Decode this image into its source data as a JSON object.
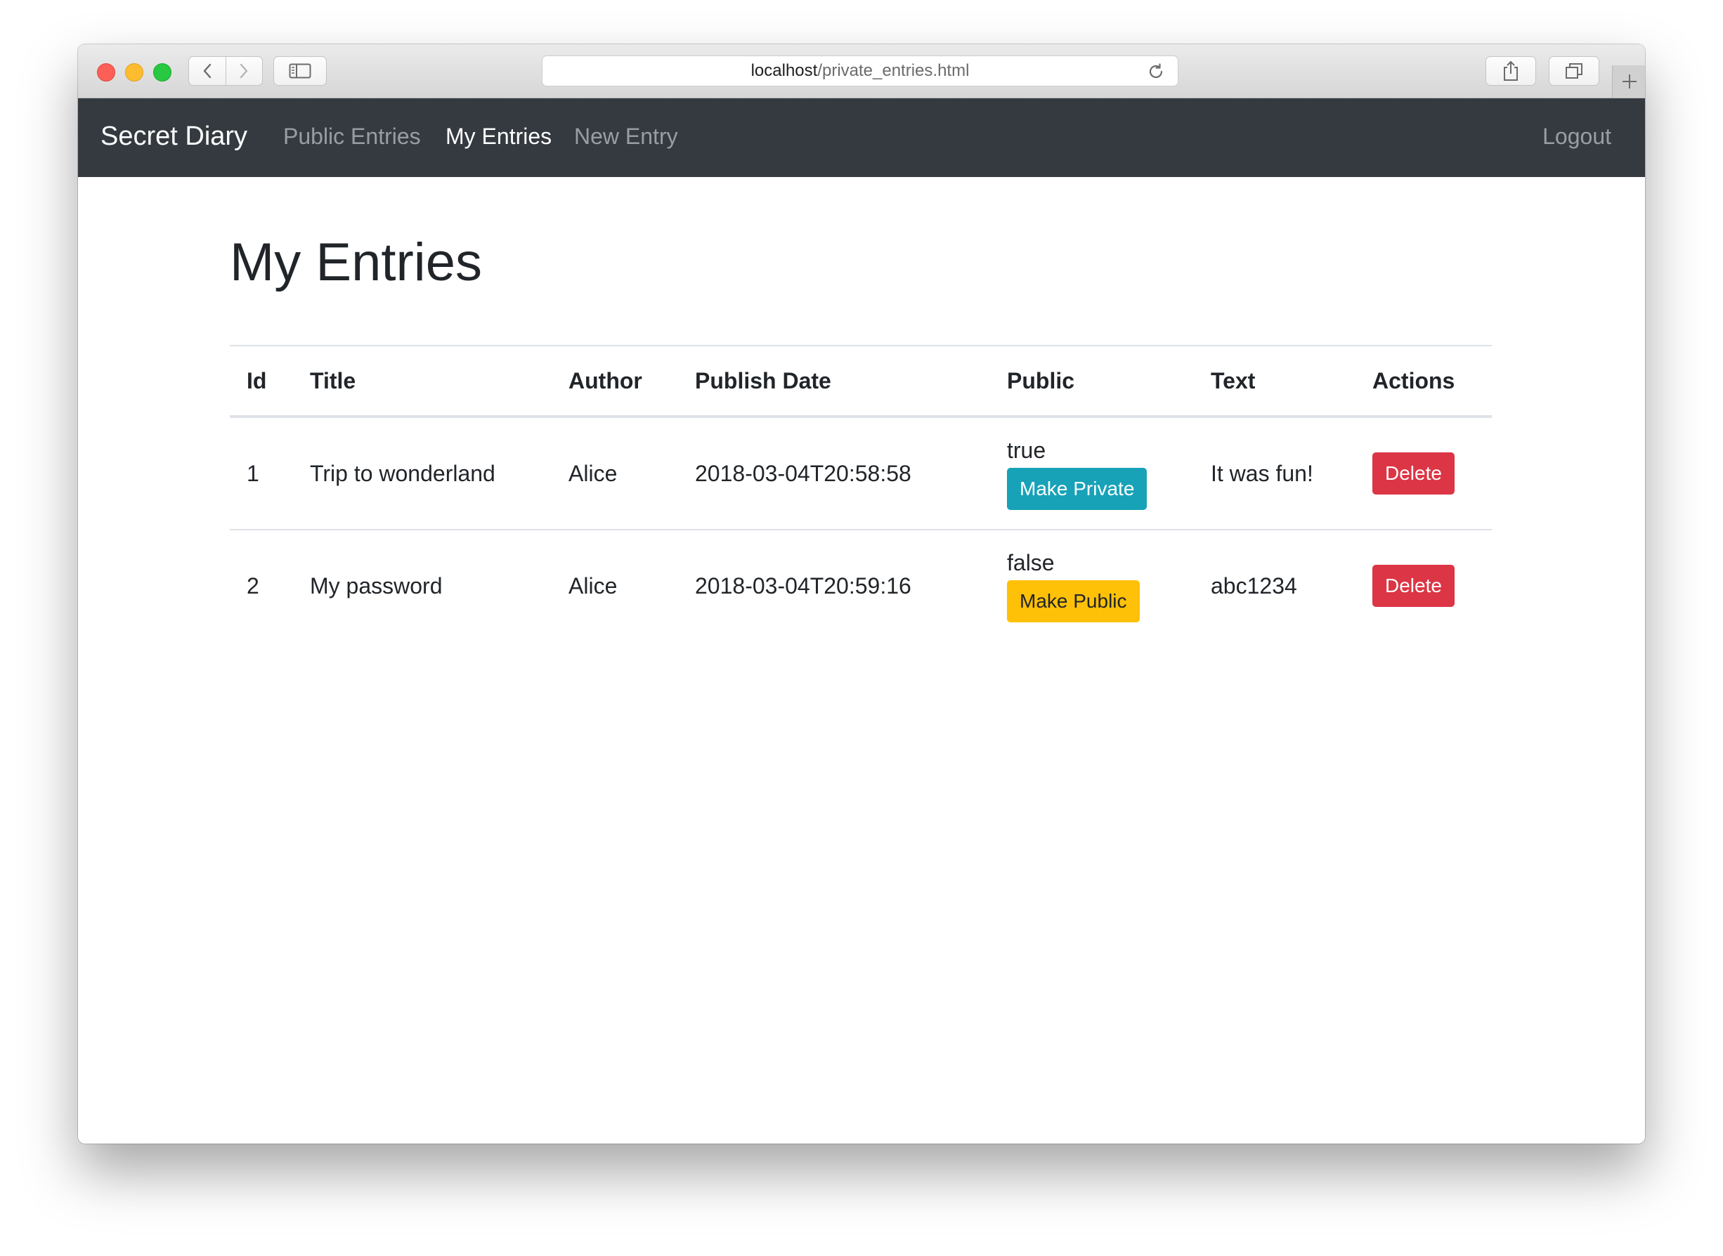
{
  "browser": {
    "url_host": "localhost",
    "url_path": "/private_entries.html"
  },
  "navbar": {
    "brand": "Secret Diary",
    "links": [
      {
        "label": "Public Entries",
        "active": false
      },
      {
        "label": "My Entries",
        "active": true
      },
      {
        "label": "New Entry",
        "active": false
      }
    ],
    "logout": "Logout"
  },
  "page": {
    "title": "My Entries"
  },
  "table": {
    "headers": [
      "Id",
      "Title",
      "Author",
      "Publish Date",
      "Public",
      "Text",
      "Actions"
    ],
    "rows": [
      {
        "id": "1",
        "title": "Trip to wonderland",
        "author": "Alice",
        "publish_date": "2018-03-04T20:58:58",
        "public": "true",
        "toggle_label": "Make Private",
        "text": "It was fun!",
        "delete_label": "Delete"
      },
      {
        "id": "2",
        "title": "My password",
        "author": "Alice",
        "publish_date": "2018-03-04T20:59:16",
        "public": "false",
        "toggle_label": "Make Public",
        "text": "abc1234",
        "delete_label": "Delete"
      }
    ]
  },
  "colors": {
    "navbar_bg": "#343a40",
    "make_private": "#17a2b8",
    "make_public": "#ffc107",
    "delete": "#dc3545"
  }
}
